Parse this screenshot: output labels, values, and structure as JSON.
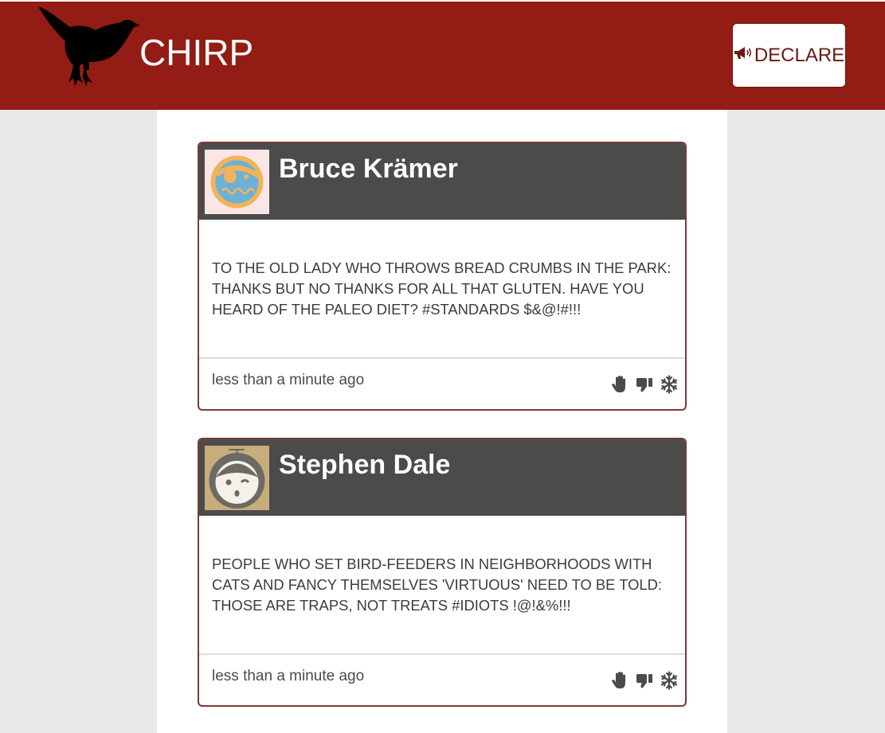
{
  "header": {
    "brand": "CHIRP",
    "declare_label": "DECLARE"
  },
  "posts": [
    {
      "author": "Bruce Krämer",
      "avatar": "pirate-avatar",
      "text": "TO THE OLD LADY WHO THROWS BREAD CRUMBS IN THE PARK: THANKS BUT NO THANKS FOR ALL THAT GLUTEN. HAVE YOU HEARD OF THE PALEO DIET? #STANDARDS $&@!#!!!",
      "timestamp": "less than a minute ago"
    },
    {
      "author": "Stephen Dale",
      "avatar": "propeller-hat-avatar",
      "text": "PEOPLE WHO SET BIRD-FEEDERS IN NEIGHBORHOODS WITH CATS AND FANCY THEMSELVES 'VIRTUOUS' NEED TO BE TOLD: THOSE ARE TRAPS, NOT TREATS #IDIOTS !@!&%!!!",
      "timestamp": "less than a minute ago"
    }
  ],
  "actions": [
    "raised-hand-icon",
    "thumbs-down-icon",
    "snowflake-icon"
  ],
  "colors": {
    "header_bg": "#931c14",
    "card_head_bg": "#4b4b4b",
    "card_border": "#7a3a36",
    "page_bg": "#e9e9e9"
  }
}
